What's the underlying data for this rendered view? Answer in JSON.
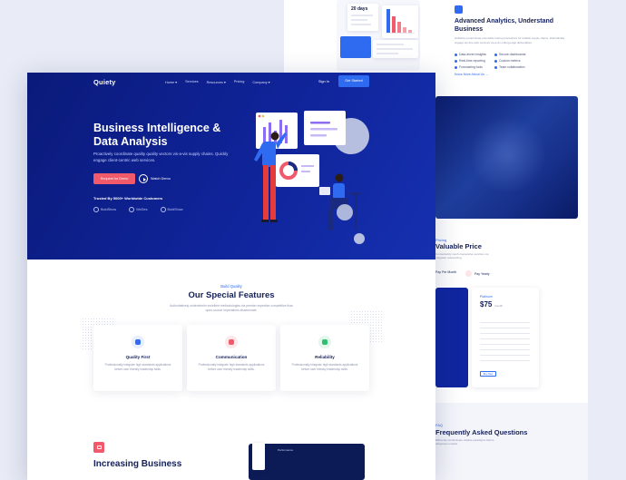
{
  "back": {
    "mock_days": "20 days",
    "section_title": "Advanced Analytics, Understand Business",
    "section_desc": "Holisticly predominate extensible testing procedures for reliable supply chains. Dramatically engage top-line web services vis-a-vis cutting-edge deliverables.",
    "checks": [
      "Data-driven insights",
      "Real-time reporting",
      "Forecasting tools",
      "Secure dashboards",
      "Custom metrics",
      "Team collaboration"
    ],
    "learn_more": "Know More About Us  →",
    "pricing_eyebrow": "Pricing",
    "pricing_title": "Valuable Price",
    "pricing_desc": "Conveniently mesh cooperative services via magnetic outsourcing.",
    "toggle_monthly": "Pay Per Month",
    "toggle_yearly": "Pay Yearly",
    "plan_name": "Platinum",
    "plan_price": "$75",
    "plan_period": "/month",
    "plan_button": "Buy Now",
    "faq_eyebrow": "FAQ",
    "faq_title": "Frequently Asked Questions",
    "faq_desc": "Efficiently productivate reliable paradigms before ubiquitous models."
  },
  "hero": {
    "logo": "Quiety",
    "nav": [
      "Home ▾",
      "Services",
      "Resources ▾",
      "Pricing",
      "Company ▾"
    ],
    "signin": "Sign In",
    "get_started": "Get Started",
    "title": "Business Intelligence & Data Analysis",
    "desc": "Proactively coordinate quality quality vectors vis-a-vis supply chains. Quickly engage client-centric web services.",
    "request_demo": "Request for Demo",
    "watch_demo": "Watch Demo",
    "trusted": "Trusted By 5000+ Worldwide Customers",
    "brands": [
      "BoldShow",
      "WeDes",
      "BoldShow"
    ]
  },
  "features": {
    "eyebrow": "Build Quality",
    "title": "Our Special Features",
    "subtitle": "Authoritatively underwhelm excellent methodologies via premier expertise competitive than open-source imperatives disseminate.",
    "cards": [
      {
        "title": "Quality First",
        "text": "Professionally integrate high standards applications before user friendly leadership skills.",
        "icon_color": "#2f6bf0",
        "icon_bg": "#e6eeff"
      },
      {
        "title": "Communication",
        "text": "Professionally integrate high standards applications before user friendly leadership skills.",
        "icon_color": "#f05a6a",
        "icon_bg": "#fde7ea"
      },
      {
        "title": "Reliability",
        "text": "Professionally integrate high standards applications before user friendly leadership skills.",
        "icon_color": "#2fbf71",
        "icon_bg": "#e3f7ec"
      }
    ]
  },
  "bottom": {
    "title": "Increasing Business",
    "mock_label": "Performance"
  }
}
